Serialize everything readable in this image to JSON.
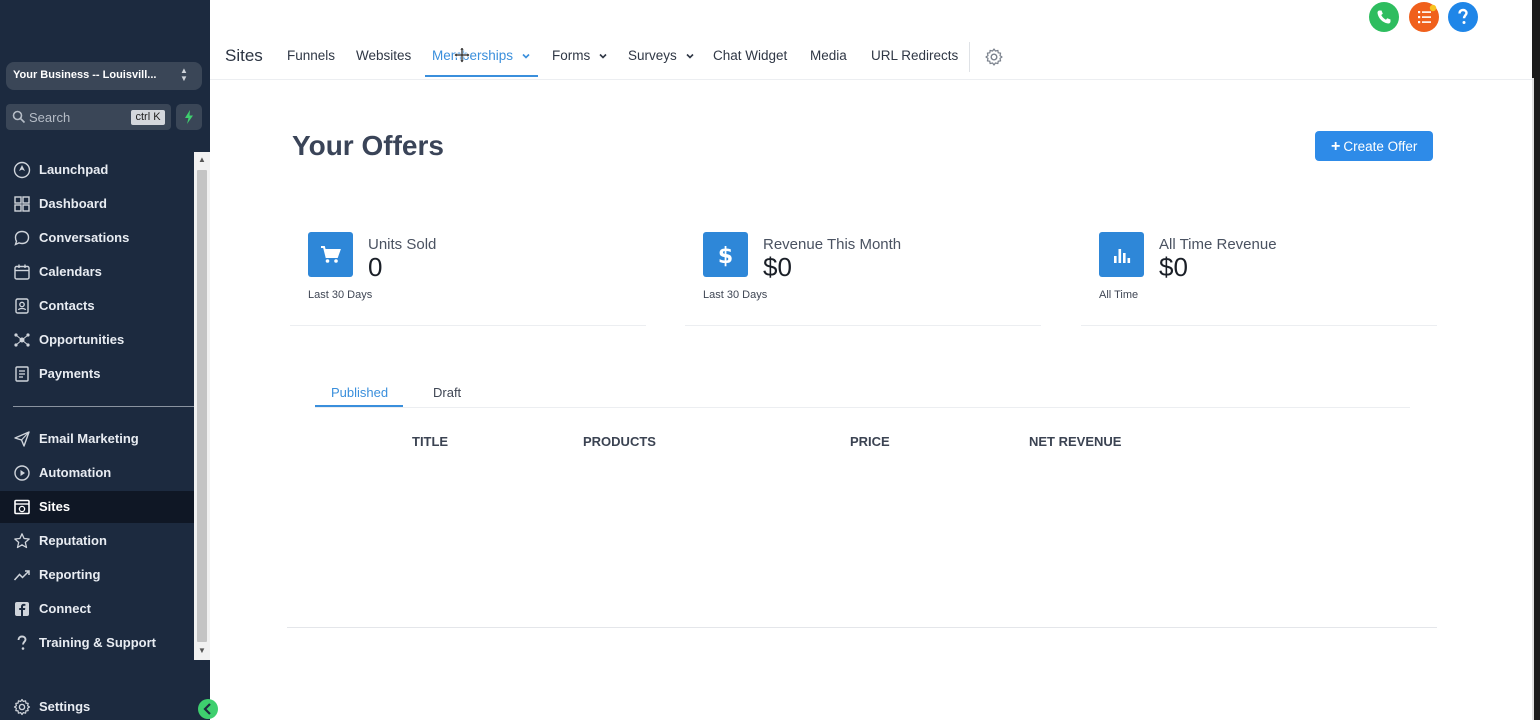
{
  "sidebar": {
    "business": "Your Business -- Louisvill...",
    "search": {
      "placeholder": "Search",
      "shortcut": "ctrl K"
    },
    "items": [
      {
        "label": "Launchpad",
        "icon": "launchpad-icon"
      },
      {
        "label": "Dashboard",
        "icon": "dashboard-icon"
      },
      {
        "label": "Conversations",
        "icon": "chat-bubble-icon"
      },
      {
        "label": "Calendars",
        "icon": "calendar-icon"
      },
      {
        "label": "Contacts",
        "icon": "contacts-icon"
      },
      {
        "label": "Opportunities",
        "icon": "opportunities-icon"
      },
      {
        "label": "Payments",
        "icon": "payments-icon"
      },
      {
        "label": "Email Marketing",
        "icon": "send-icon"
      },
      {
        "label": "Automation",
        "icon": "automation-icon"
      },
      {
        "label": "Sites",
        "icon": "sites-icon",
        "active": true
      },
      {
        "label": "Reputation",
        "icon": "star-icon"
      },
      {
        "label": "Reporting",
        "icon": "trend-icon"
      },
      {
        "label": "Connect",
        "icon": "facebook-icon"
      },
      {
        "label": "Training & Support",
        "icon": "question-icon"
      }
    ],
    "settings": "Settings"
  },
  "topnav": {
    "title": "Sites",
    "tabs": {
      "funnels": "Funnels",
      "websites": "Websites",
      "memberships": "Memberships",
      "forms": "Forms",
      "surveys": "Surveys",
      "chat_widget": "Chat Widget",
      "media": "Media",
      "url_redirects": "URL Redirects"
    },
    "active_tab": "Memberships"
  },
  "header_buttons": [
    {
      "icon": "phone-icon",
      "color": "#2ebd5f"
    },
    {
      "icon": "list-icon",
      "color": "#f0601c"
    },
    {
      "icon": "help-icon",
      "color": "#1f86e8"
    }
  ],
  "main": {
    "title": "Your Offers",
    "create_offer": "Create Offer",
    "stats": [
      {
        "label": "Units Sold",
        "value": "0",
        "sub": "Last 30 Days",
        "icon": "cart-icon"
      },
      {
        "label": "Revenue This Month",
        "value": "$0",
        "sub": "Last 30 Days",
        "icon": "dollar-icon"
      },
      {
        "label": "All Time Revenue",
        "value": "$0",
        "sub": "All Time",
        "icon": "bar-chart-icon"
      }
    ],
    "tabs": {
      "published": "Published",
      "draft": "Draft"
    },
    "active_tab": "Published",
    "columns": {
      "title": "TITLE",
      "products": "PRODUCTS",
      "price": "PRICE",
      "net_revenue": "NET REVENUE"
    }
  },
  "colors": {
    "accent": "#2e8be8",
    "sidebar_bg": "#1c2a3f",
    "success": "#3ecf6e"
  }
}
